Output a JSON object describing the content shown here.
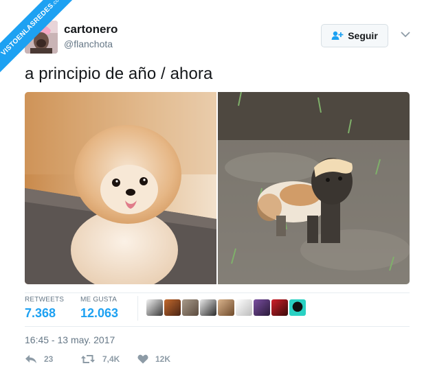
{
  "watermark": {
    "text": "VISTOENLASREDES",
    "suffix": ".com"
  },
  "user": {
    "name": "cartonero",
    "handle": "@flanchota",
    "avatar_icon": "avatar-image"
  },
  "follow_button": {
    "label": "Seguir",
    "icon": "add-user-icon"
  },
  "tweet": {
    "text": "a principio de año / ahora"
  },
  "media": {
    "left_photo": "fluffy-pomeranian-puppy",
    "right_photo": "muddy-pomeranian-in-puddle"
  },
  "stats": {
    "retweets_label": "RETWEETS",
    "retweets_value": "7.368",
    "likes_label": "ME GUSTA",
    "likes_value": "12.063"
  },
  "likers": [
    "avatar-1",
    "avatar-2",
    "avatar-3",
    "avatar-4",
    "avatar-5",
    "avatar-6",
    "avatar-7",
    "avatar-8",
    "avatar-9"
  ],
  "timestamp": "16:45 - 13 may. 2017",
  "actions": {
    "reply_count": "23",
    "retweet_count": "7,4K",
    "like_count": "12K"
  },
  "colors": {
    "accent": "#1da1f2",
    "muted": "#657786",
    "text": "#14171a"
  }
}
